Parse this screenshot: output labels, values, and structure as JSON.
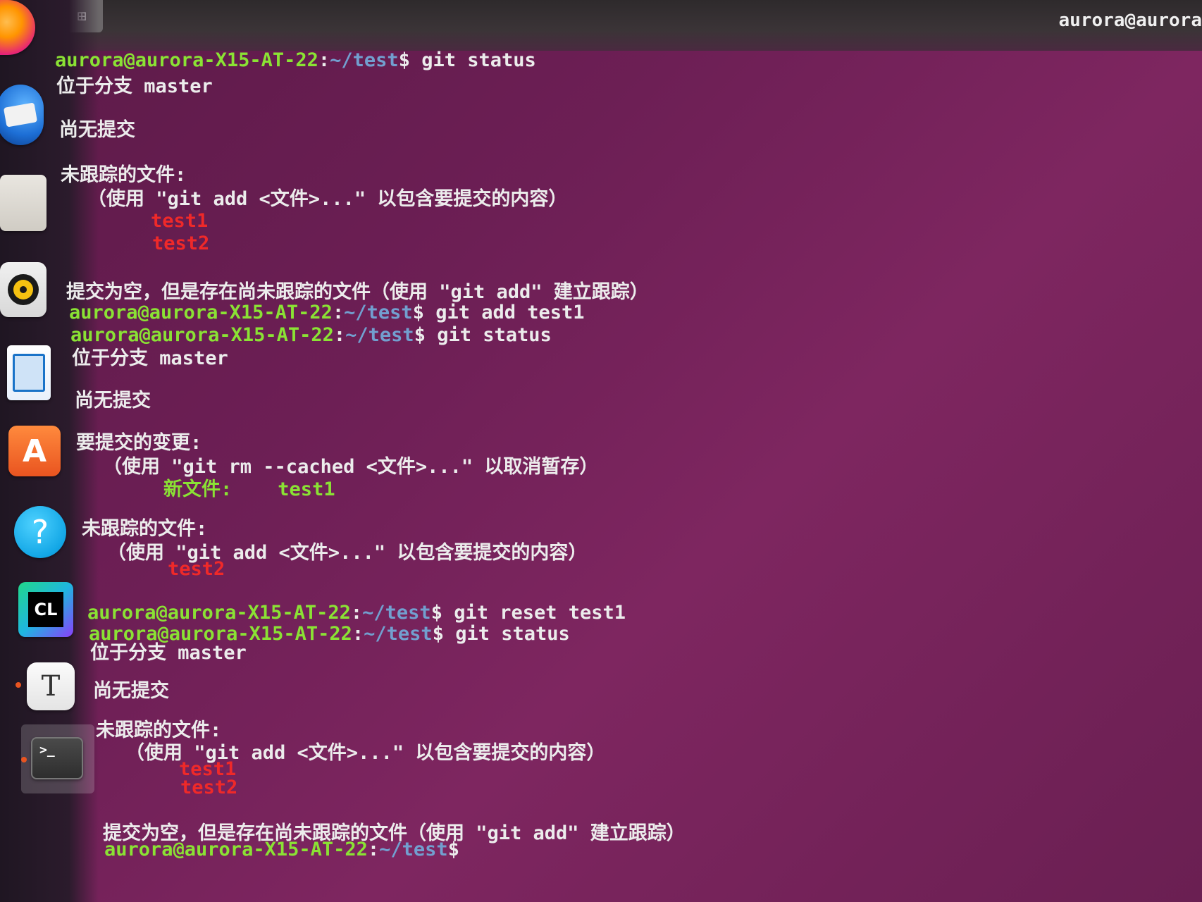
{
  "window": {
    "title": "aurora@aurora",
    "new_tab_symbol": "⊞"
  },
  "dock": {
    "apps": [
      {
        "name": "firefox-icon"
      },
      {
        "name": "thunderbird-icon"
      },
      {
        "name": "files-icon"
      },
      {
        "name": "rhythmbox-icon"
      },
      {
        "name": "libreoffice-writer-icon"
      },
      {
        "name": "app-center-icon",
        "label": "A"
      },
      {
        "name": "help-icon",
        "label": "?"
      },
      {
        "name": "clion-icon",
        "label": "CL"
      },
      {
        "name": "text-editor-icon",
        "label": "T"
      },
      {
        "name": "terminal-icon",
        "label": ">_"
      }
    ]
  },
  "prompt": {
    "user": "aurora@aurora-X15-AT-22",
    "sep": ":",
    "path": "~/test",
    "dollar": "$"
  },
  "commands": {
    "c1": " git status",
    "c2": " git add test1",
    "c3": " git status",
    "c4": " git reset test1",
    "c5": " git status",
    "c6": ""
  },
  "output": {
    "on_branch": "位于分支 master",
    "no_commits": "尚无提交",
    "untracked_header": "未跟踪的文件:",
    "untracked_hint": "（使用 \"git add <文件>...\" 以包含要提交的内容）",
    "to_commit_header": "要提交的变更:",
    "to_commit_hint": "（使用 \"git rm --cached <文件>...\" 以取消暂存）",
    "new_file_label": "新文件:",
    "new_file_name": "test1",
    "file1": "test1",
    "file2": "test2",
    "nothing_added": "提交为空，但是存在尚未跟踪的文件（使用 \"git add\" 建立跟踪）"
  },
  "colors": {
    "background": "#6d1f55",
    "prompt_user": "#8ae234",
    "prompt_path": "#729fcf",
    "untracked": "#ef2929",
    "staged": "#8ae234"
  }
}
